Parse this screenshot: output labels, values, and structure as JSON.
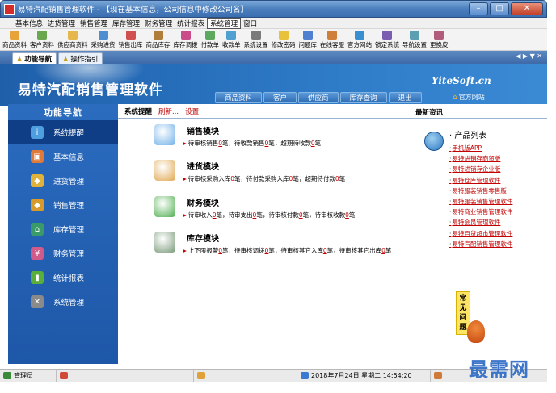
{
  "window": {
    "title": "易特汽配销售管理软件 - 【现在基本信息，公司信息中修改公司名】",
    "min_label": "–",
    "max_label": "□",
    "close_label": "✕"
  },
  "menubar": [
    "基本信息",
    "进货管理",
    "销售管理",
    "库存管理",
    "财务管理",
    "统计报表",
    "系统管理",
    "窗口"
  ],
  "menubar_active": 6,
  "toolbar": [
    {
      "label": "商品资料",
      "color": "#e8a23a"
    },
    {
      "label": "客户资料",
      "color": "#6aa84f"
    },
    {
      "label": "供应商资料",
      "color": "#e6b84c"
    },
    {
      "label": "采购进货",
      "color": "#4f8fd0"
    },
    {
      "label": "销售出库",
      "color": "#d04f4f"
    },
    {
      "label": "商品库存",
      "color": "#b07d3a"
    },
    {
      "label": "库存调拨",
      "color": "#c94b8a"
    },
    {
      "label": "付款单",
      "color": "#5ca85c"
    },
    {
      "label": "收款单",
      "color": "#4f9fd0"
    },
    {
      "label": "系统设置",
      "color": "#7a7a7a"
    },
    {
      "label": "修改密码",
      "color": "#e8c23a"
    },
    {
      "label": "问题库",
      "color": "#4f7fd0"
    },
    {
      "label": "在线客服",
      "color": "#d07f3a"
    },
    {
      "label": "官方网站",
      "color": "#3a8fd0"
    },
    {
      "label": "锁定系统",
      "color": "#7a5cb0"
    },
    {
      "label": "导航设置",
      "color": "#5c9fb0"
    },
    {
      "label": "更换皮",
      "color": "#b05c7a"
    }
  ],
  "tabs": [
    {
      "label": "功能导航"
    },
    {
      "label": "操作指引"
    }
  ],
  "tab_nav": "◀ ▶ ▼ ✕",
  "banner": {
    "brand": "易特汽配销售管理软件",
    "site": "YiteSoft.cn",
    "nav": [
      "商品资料",
      "客户",
      "供应商",
      "库存查询",
      "退出"
    ],
    "official": "官方网站"
  },
  "sidebar": {
    "title": "功能导航",
    "items": [
      {
        "label": "系统提醒",
        "icon": "info-icon",
        "color": "#4f9fe0",
        "glyph": "i"
      },
      {
        "label": "基本信息",
        "icon": "cubes-icon",
        "color": "#e07a3a",
        "glyph": "▣"
      },
      {
        "label": "进货管理",
        "icon": "box-in-icon",
        "color": "#e0b23a",
        "glyph": "◆"
      },
      {
        "label": "销售管理",
        "icon": "box-out-icon",
        "color": "#d89a2a",
        "glyph": "◆"
      },
      {
        "label": "库存管理",
        "icon": "warehouse-icon",
        "color": "#3a9a6a",
        "glyph": "⌂"
      },
      {
        "label": "财务管理",
        "icon": "finance-icon",
        "color": "#d05a8a",
        "glyph": "¥"
      },
      {
        "label": "统计报表",
        "icon": "bar-chart-icon",
        "color": "#5aae3a",
        "glyph": "▮"
      },
      {
        "label": "系统管理",
        "icon": "tools-icon",
        "color": "#8a8a8a",
        "glyph": "✕"
      }
    ]
  },
  "content": {
    "tabs": [
      "系统提醒",
      "刷新...",
      "设置"
    ],
    "latest": "最新资讯",
    "modules": [
      {
        "title": "销售模块",
        "icon_color": "#6fb0e8",
        "parts": [
          "待审核销售",
          "0",
          "笔，待收款销售",
          "0",
          "笔，超期待收款",
          "0",
          "笔"
        ]
      },
      {
        "title": "进货模块",
        "icon_color": "#e0a850",
        "parts": [
          "待审核采购入库",
          "0",
          "笔，待付款采购入库",
          "0",
          "笔，超期待付款",
          "0",
          "笔"
        ]
      },
      {
        "title": "财务模块",
        "icon_color": "#4fae4f",
        "parts": [
          "待审收入",
          "0",
          "笔，待审支出",
          "0",
          "笔，待审核付款",
          "0",
          "笔，待审核收款",
          "0",
          "笔"
        ]
      },
      {
        "title": "库存模块",
        "icon_color": "#7a9a7a",
        "parts": [
          "上下限报警",
          "0",
          "笔，待审核调拨",
          "0",
          "笔，待审核其它入库",
          "0",
          "笔，待审核其它出库",
          "0",
          "笔"
        ]
      }
    ],
    "products_title": "产品列表",
    "products": [
      "手机版APP",
      "易特进销存商贸版",
      "易特进销存企业版",
      "易特仓库管理软件",
      "易特服装销售零售版",
      "易特服装销售管理软件",
      "易特商业销售管理软件",
      "易特会员管理软件",
      "易特百货超市管理软件",
      "易特汽配销售管理软件"
    ],
    "faq": [
      "常",
      "见",
      "问",
      "题"
    ]
  },
  "statusbar": {
    "user": "管理员",
    "datetime": "2018年7月24日 星期二 14:54:20"
  },
  "watermark": "最需网"
}
